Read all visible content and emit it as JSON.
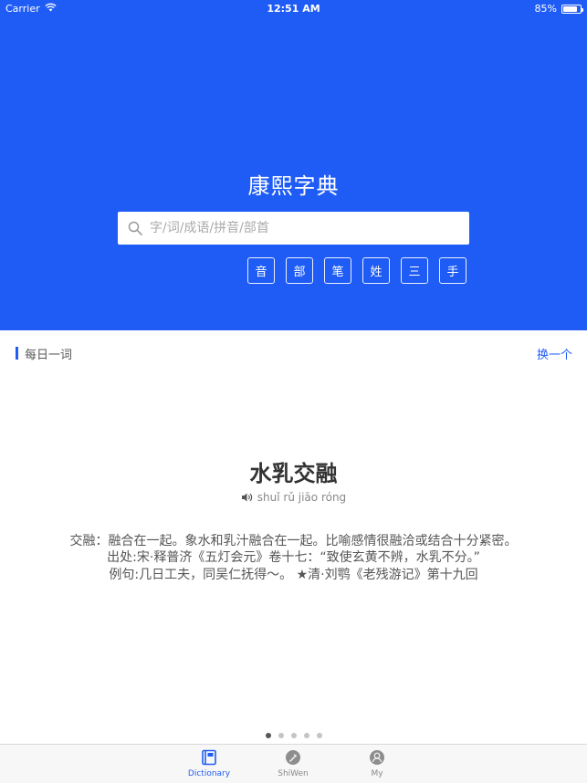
{
  "status_bar": {
    "carrier": "Carrier",
    "time": "12:51 AM",
    "battery": "85%",
    "battery_level": 0.85
  },
  "app_title": "康熙字典",
  "search": {
    "placeholder": "字/词/成语/拼音/部首",
    "value": ""
  },
  "modes": [
    "音",
    "部",
    "笔",
    "姓",
    "三",
    "手"
  ],
  "daily_word": {
    "section_title": "每日一词",
    "change_label": "换一个",
    "word": "水乳交融",
    "pinyin": "shuǐ rǔ jiāo róng",
    "lines": [
      "交融：融合在一起。象水和乳汁融合在一起。比喻感情很融洽或结合十分紧密。",
      "出处:宋·释普济《五灯会元》卷十七：“致使玄黄不辨，水乳不分。”",
      "例句:几日工夫，同吴仁抚得～。 ★清·刘鹗《老残游记》第十九回"
    ]
  },
  "pagination": {
    "count": 5,
    "active": 0
  },
  "tabs": [
    {
      "label": "Dictionary",
      "icon": "book-icon",
      "active": true
    },
    {
      "label": "ShiWen",
      "icon": "quill-icon",
      "active": false
    },
    {
      "label": "My",
      "icon": "user-icon",
      "active": false
    }
  ],
  "colors": {
    "brand_blue": "#1f5cf5",
    "tab_inactive": "#888888"
  }
}
